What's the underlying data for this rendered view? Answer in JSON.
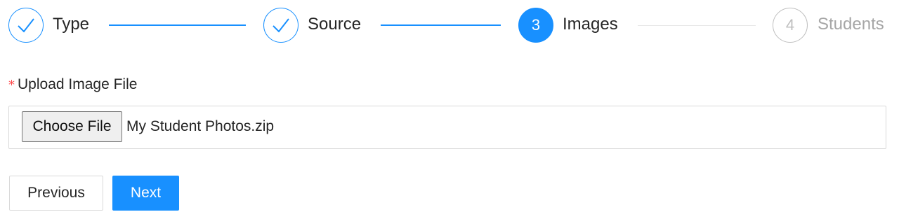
{
  "steps": [
    {
      "title": "Type",
      "status": "finished",
      "icon": "check-icon"
    },
    {
      "title": "Source",
      "status": "finished",
      "icon": "check-icon"
    },
    {
      "number": "3",
      "title": "Images",
      "status": "active"
    },
    {
      "number": "4",
      "title": "Students",
      "status": "waiting"
    }
  ],
  "form": {
    "required_mark": "*",
    "upload_label": "Upload Image File",
    "choose_file_label": "Choose File",
    "file_name": "My Student Photos.zip"
  },
  "actions": {
    "previous_label": "Previous",
    "next_label": "Next"
  },
  "colors": {
    "primary": "#1890ff",
    "waiting": "#bfbfbf",
    "required": "#ff4d4f"
  }
}
